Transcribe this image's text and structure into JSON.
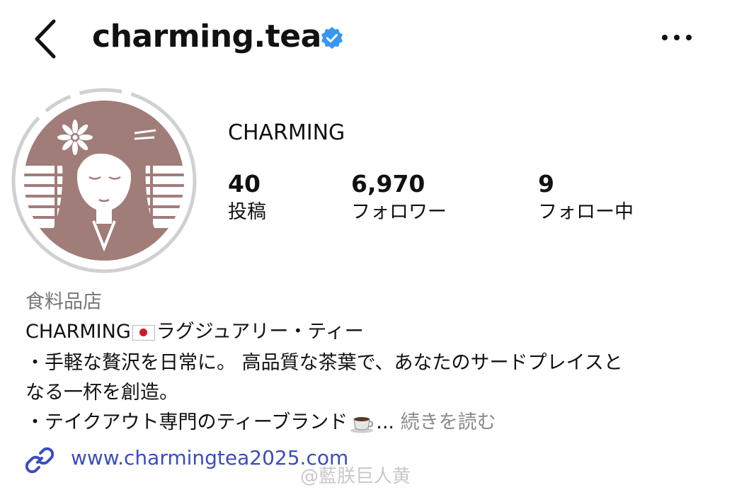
{
  "header": {
    "username": "charming.tea",
    "verified": true
  },
  "profile": {
    "display_name": "CHARMING",
    "stats": [
      {
        "value": "40",
        "label": "投稿"
      },
      {
        "value": "6,970",
        "label": "フォロワー"
      },
      {
        "value": "9",
        "label": "フォロー中"
      }
    ],
    "category": "食料品店",
    "bio": {
      "line1_prefix": "CHARMING",
      "line1_suffix": "ラグジュアリー・ティー",
      "line2": "・手軽な贅沢を日常に。 高品質な茶葉で、あなたのサードプレイスと",
      "line3": "なる一杯を創造。",
      "line4_prefix": "・テイクアウト専門のティーブランド",
      "line4_ellipsis": "...",
      "more_label": "続きを読む"
    },
    "website": "www.charmingtea2025.com"
  },
  "watermark": "@藍朕巨人黄",
  "colors": {
    "verified_badge": "#3897f0",
    "link": "#3b4cc0",
    "logo": "#a07d79",
    "muted_text": "#777777"
  },
  "icons": {
    "back": "chevron-left-icon",
    "verified": "verified-badge-icon",
    "more": "more-options-icon",
    "flag": "japan-flag-icon",
    "cup": "coffee-cup-icon",
    "link": "link-icon"
  }
}
